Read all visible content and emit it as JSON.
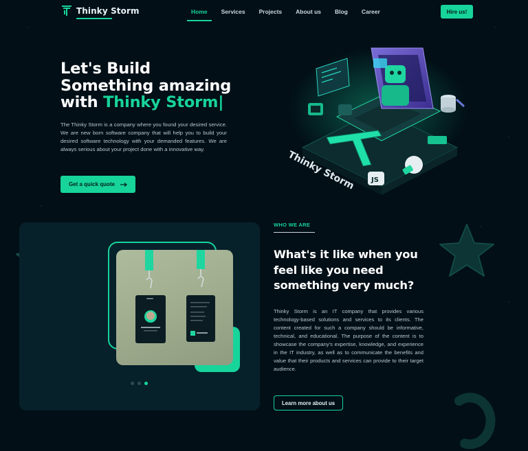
{
  "brand": {
    "name": "Thinky Storm",
    "accent": "#18d39a",
    "background": "#020f17"
  },
  "nav": {
    "items": [
      {
        "label": "Home",
        "active": true
      },
      {
        "label": "Services",
        "active": false
      },
      {
        "label": "Projects",
        "active": false
      },
      {
        "label": "About us",
        "active": false
      },
      {
        "label": "Blog",
        "active": false
      },
      {
        "label": "Career",
        "active": false
      }
    ],
    "cta": "Hire us!"
  },
  "hero": {
    "title_line1": "Let's Build",
    "title_line2": "Something amazing",
    "title_line3_prefix": "with ",
    "title_line3_accent": "Thinky Storm|",
    "description": "The Thinky Storm is a company where you found your desired service. We are new born software company that will help you to build your desired software technology with your demanded features. We are always serious about your project done with a innovative way.",
    "cta": "Get a quick quote",
    "cta_icon": "arrow-right-icon",
    "illustration_text": "Thinky Storm",
    "illustration_badge": "JS"
  },
  "about": {
    "eyebrow": "WHO WE ARE",
    "title": "What's it like when you feel like you need something very much?",
    "description": "Thinky Storm is an IT company that provides various technology-based solutions and services to its clients. The content created for such a company should be informative, technical, and educational. The purpose of the content is to showcase the company's expertise, knowledge, and experience in the IT industry, as well as to communicate the benefits and value that their products and services can provide to their target audience.",
    "cta": "Learn more about us",
    "carousel": {
      "count": 3,
      "active": 3
    }
  }
}
